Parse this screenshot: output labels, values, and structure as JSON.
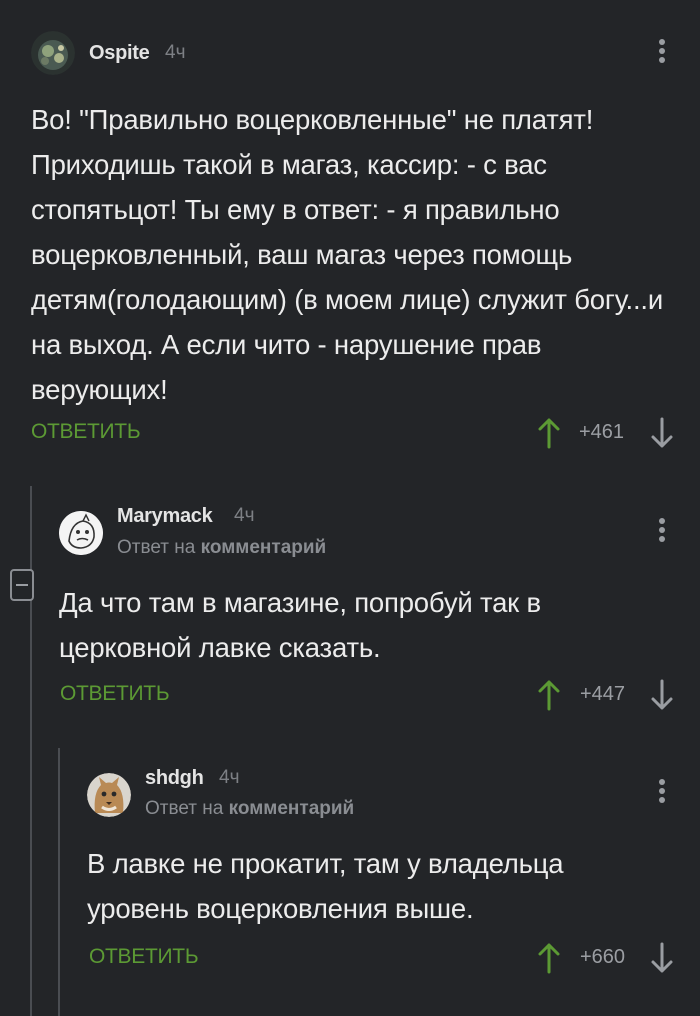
{
  "comments": [
    {
      "username": "Ospite",
      "time": "4ч",
      "text": "Во! \"Правильно воцерковленные\" не платят! Приходишь такой в магаз, кассир: - с вас стопятьцот! Ты ему в ответ: - я правильно воцерковленный, ваш магаз через помощь детям(голодающим) (в моем лице) служит богу...и на выход. А если чито - нарушение прав верующих!",
      "reply_label": "ОТВЕТИТЬ",
      "score": "+461"
    },
    {
      "username": "Marymack",
      "time": "4ч",
      "reply_to_prefix": "Ответ на",
      "reply_to_target": "комментарий",
      "text": "Да что там в магазине, попробуй так в церковной лавке сказать.",
      "reply_label": "ОТВЕТИТЬ",
      "score": "+447"
    },
    {
      "username": "shdgh",
      "time": "4ч",
      "reply_to_prefix": "Ответ на",
      "reply_to_target": "комментарий",
      "text": "В лавке не прокатит, там у владельца уровень воцерковления выше.",
      "reply_label": "ОТВЕТИТЬ",
      "score": "+660"
    }
  ],
  "colors": {
    "background": "#232528",
    "accent_green": "#5c9a34",
    "muted_text": "#8a8d92",
    "thread_line": "#4a4d52"
  },
  "icons": {
    "vote_up": "arrow-up-icon",
    "vote_down": "arrow-down-icon",
    "menu": "kebab-menu-icon",
    "collapse": "collapse-minus-icon"
  }
}
